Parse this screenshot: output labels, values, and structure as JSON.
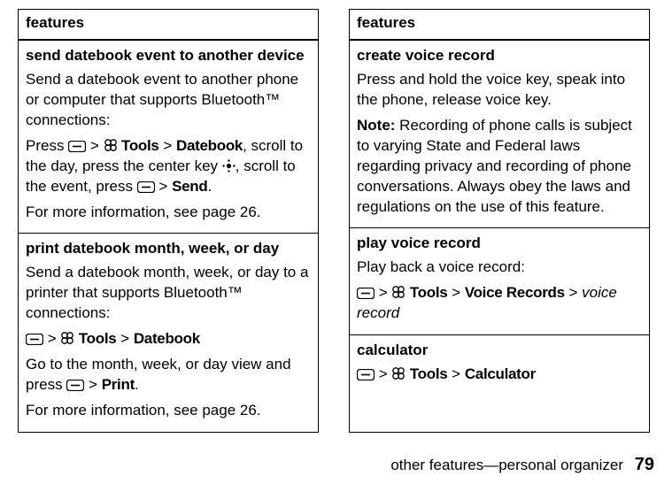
{
  "glyph": {
    "gt": ">"
  },
  "left": {
    "header": "features",
    "rows": [
      {
        "title": "send datebook event to another device",
        "p1": "Send a datebook event to another phone or computer that supports Bluetooth™ connections:",
        "p2_a": "Press ",
        "p2_b": " Tools",
        "p2_c": "Datebook",
        "p2_d": ", scroll to the day, press the center key ",
        "p2_e": ", scroll to the event, press ",
        "p2_f": "Send",
        "p2_g": ".",
        "p3": "For more information, see page 26."
      },
      {
        "title": "print datebook month, week, or day",
        "p1": "Send a datebook month, week, or day to a printer that supports Bluetooth™ connections:",
        "p2_b": " Tools",
        "p2_c": "Datebook",
        "p3": "Go to the month, week, or day view and press ",
        "p3_b": "Print",
        "p3_c": ".",
        "p4": "For more information, see page 26."
      }
    ]
  },
  "right": {
    "header": "features",
    "rows": [
      {
        "title": "create voice record",
        "p1": "Press and hold the voice key, speak into the phone, release voice key.",
        "note_label": "Note:",
        "note_body": " Recording of phone calls is subject to varying State and Federal laws regarding privacy and recording of phone conversations. Always obey the laws and regulations on the use of this feature."
      },
      {
        "title": "play voice record",
        "p1": "Play back a voice record:",
        "p2_b": " Tools",
        "p2_c": "Voice Records",
        "p2_d": "voice record"
      },
      {
        "title": "calculator",
        "p2_b": " Tools",
        "p2_c": "Calculator"
      }
    ]
  },
  "footer": {
    "section": "other features—personal organizer",
    "page": "79"
  }
}
